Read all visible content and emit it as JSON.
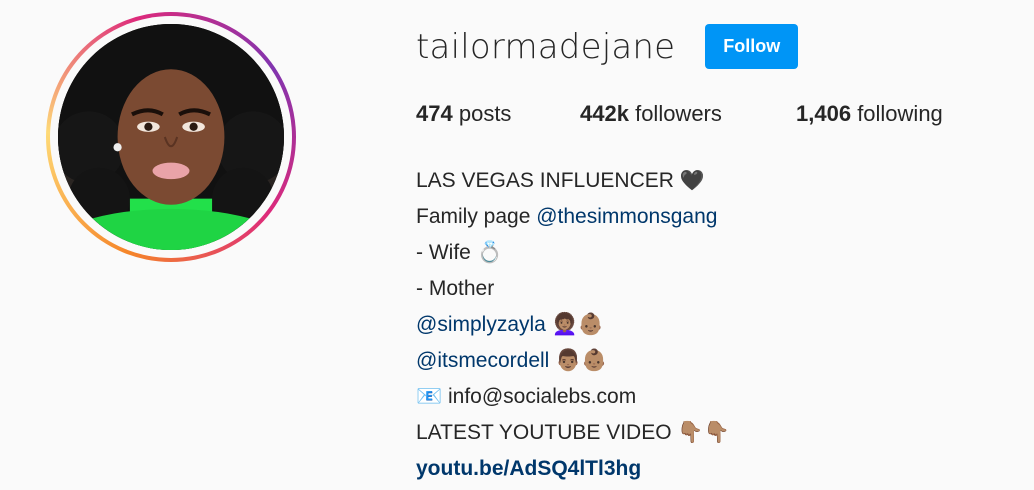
{
  "profile": {
    "username": "tailormadejane",
    "follow_label": "Follow",
    "avatar_alt": "profile picture"
  },
  "stats": {
    "posts_count": "474",
    "posts_label": "posts",
    "followers_count": "442k",
    "followers_label": "followers",
    "following_count": "1,406",
    "following_label": "following"
  },
  "bio": {
    "line1": "LAS VEGAS INFLUENCER",
    "line1_emoji": "🖤",
    "line2_prefix": "Family page ",
    "line2_mention": "@thesimmonsgang",
    "line3": "- Wife",
    "line3_emoji": "💍",
    "line4": "- Mother",
    "line5_mention": "@simplyzayla",
    "line5_suffix": " 👩🏽‍🦱👶🏽",
    "line6_mention": "@itsmecordell",
    "line6_suffix": " 👨🏽👶🏽",
    "line7_icon": "📧",
    "line7": " info@socialebs.com",
    "line8": "LATEST YOUTUBE VIDEO",
    "line8_suffix": " 👇🏽👇🏽",
    "link": "youtu.be/AdSQ4lTl3hg"
  }
}
